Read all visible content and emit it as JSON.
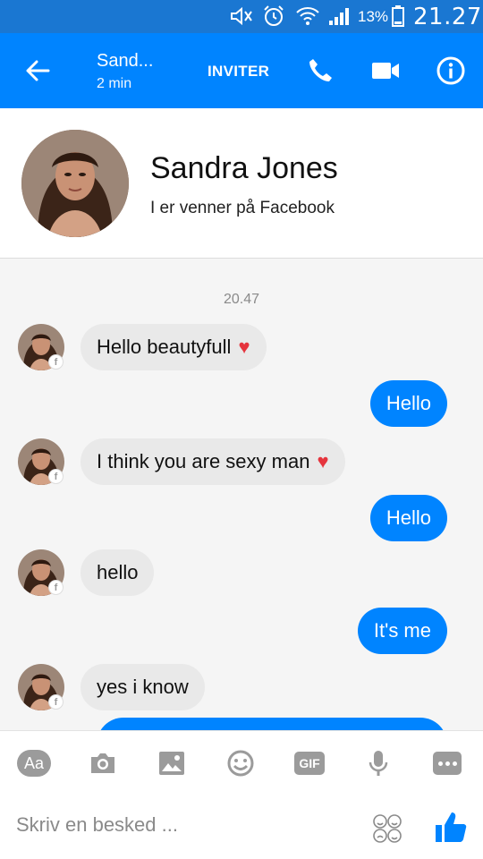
{
  "status_bar": {
    "battery_percent": "13%",
    "time": "21.27",
    "icons": [
      "mute-icon",
      "alarm-icon",
      "wifi-icon",
      "signal-icon",
      "battery-icon"
    ]
  },
  "header": {
    "contact_name": "Sand...",
    "contact_status": "2 min",
    "invite_label": "INVITER",
    "icons": [
      "back-arrow-icon",
      "phone-icon",
      "video-camera-icon",
      "info-icon"
    ]
  },
  "profile": {
    "name": "Sandra Jones",
    "subtitle": "I er venner på Facebook"
  },
  "thread": {
    "timestamp": "20.47",
    "messages": [
      {
        "dir": "in",
        "text": "Hello beautyfull",
        "heart": true
      },
      {
        "dir": "out",
        "text": "Hello"
      },
      {
        "dir": "in",
        "text": "I think you are sexy man",
        "heart": true
      },
      {
        "dir": "out",
        "text": "Hello"
      },
      {
        "dir": "in",
        "text": "hello"
      },
      {
        "dir": "out",
        "text": "It's me"
      },
      {
        "dir": "in",
        "text": "yes i know"
      }
    ],
    "heart_glyph": "♥",
    "fb_badge_glyph": "f"
  },
  "composer": {
    "aa_label": "Aa",
    "gif_label": "GIF",
    "placeholder": "Skriv en besked ...",
    "tools": [
      "text-style-icon",
      "camera-icon",
      "gallery-icon",
      "emoji-icon",
      "gif-icon",
      "microphone-icon",
      "more-icon"
    ],
    "like_icon": "thumbs-up-icon"
  },
  "colors": {
    "status_bar": "#1a77d2",
    "header": "#0084ff",
    "outgoing_bubble": "#0084ff",
    "incoming_bubble": "#e9e9e9",
    "heart": "#e5343d"
  }
}
